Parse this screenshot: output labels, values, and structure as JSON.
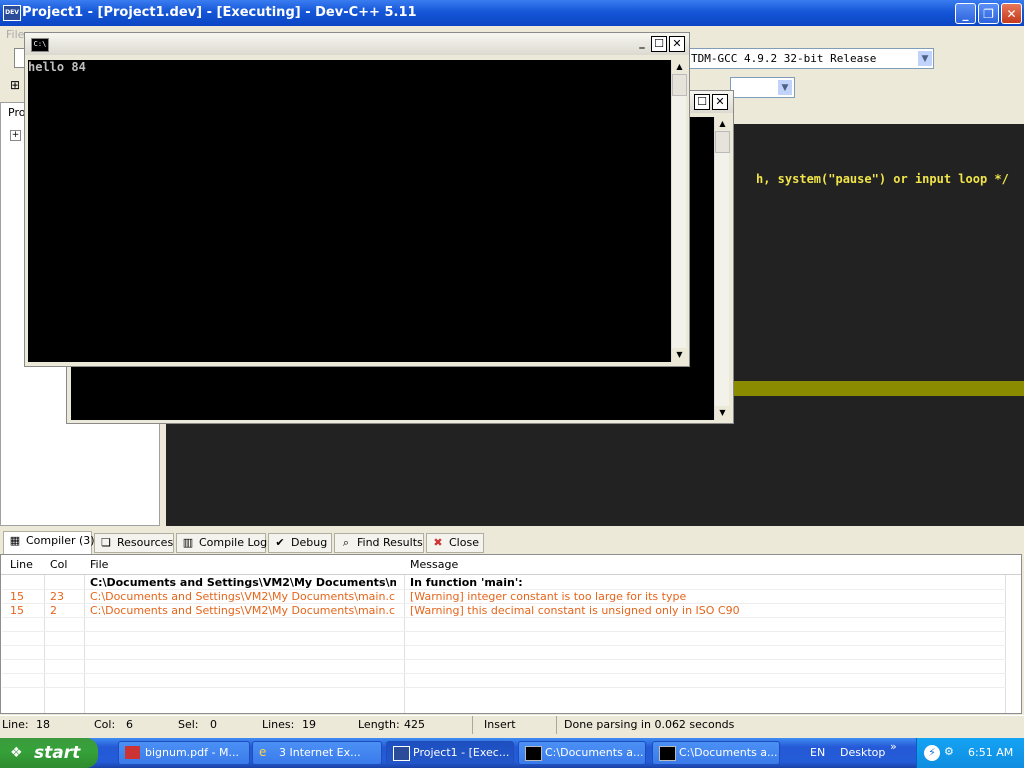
{
  "main_window": {
    "title": "Project1 - [Project1.dev] - [Executing] - Dev-C++ 5.11",
    "icon_label": "DEV"
  },
  "toolbar": {
    "compiler_select_value": "TDM-GCC 4.9.2 32-bit Release",
    "menu_file_partial": "File"
  },
  "left_panel": {
    "tab_label_partial": "Pro",
    "tree_expand": "+"
  },
  "editor": {
    "visible_code": "h, system(\"pause\") or input loop */"
  },
  "console_front": {
    "icon_label": "C:\\",
    "output_line": "hello 84"
  },
  "bottom_tabs": [
    {
      "label": "Compiler (3)",
      "icon": "grid-icon"
    },
    {
      "label": "Resources",
      "icon": "resources-icon"
    },
    {
      "label": "Compile Log",
      "icon": "bar-chart-icon"
    },
    {
      "label": "Debug",
      "icon": "check-icon"
    },
    {
      "label": "Find Results",
      "icon": "find-icon"
    },
    {
      "label": "Close",
      "icon": "close-icon"
    }
  ],
  "messages": {
    "headers": {
      "line": "Line",
      "col": "Col",
      "file": "File",
      "message": "Message"
    },
    "rows": [
      {
        "line": "",
        "col": "",
        "file": "C:\\Documents and Settings\\VM2\\My Documents\\m...",
        "message": "In function 'main':"
      },
      {
        "line": "15",
        "col": "23",
        "file": "C:\\Documents and Settings\\VM2\\My Documents\\main.c",
        "message": "[Warning] integer constant is too large for its type"
      },
      {
        "line": "15",
        "col": "2",
        "file": "C:\\Documents and Settings\\VM2\\My Documents\\main.c",
        "message": "[Warning] this decimal constant is unsigned only in ISO C90"
      }
    ]
  },
  "status_bar": {
    "line_label": "Line:",
    "line_value": "18",
    "col_label": "Col:",
    "col_value": "6",
    "sel_label": "Sel:",
    "sel_value": "0",
    "lines_label": "Lines:",
    "lines_value": "19",
    "length_label": "Length:",
    "length_value": "425",
    "mode": "Insert",
    "message": "Done parsing in 0.062 seconds"
  },
  "taskbar": {
    "start_label": "start",
    "tasks": [
      {
        "label": "bignum.pdf - M...",
        "icon": "pdf-icon"
      },
      {
        "label": "3 Internet Ex...",
        "icon": "ie-icon"
      },
      {
        "label": "Project1 - [Exec...",
        "icon": "devcpp-icon"
      },
      {
        "label": "C:\\Documents a...",
        "icon": "cmd-icon"
      },
      {
        "label": "C:\\Documents a...",
        "icon": "cmd-icon"
      }
    ],
    "language": "EN",
    "desktop_label": "Desktop",
    "chevron": "»",
    "clock": "6:51 AM"
  },
  "colors": {
    "editor_bg": "#222222",
    "editor_text": "#f0e44a",
    "warning_text": "#e5651b",
    "titlebar_blue": "#0a45c4"
  }
}
